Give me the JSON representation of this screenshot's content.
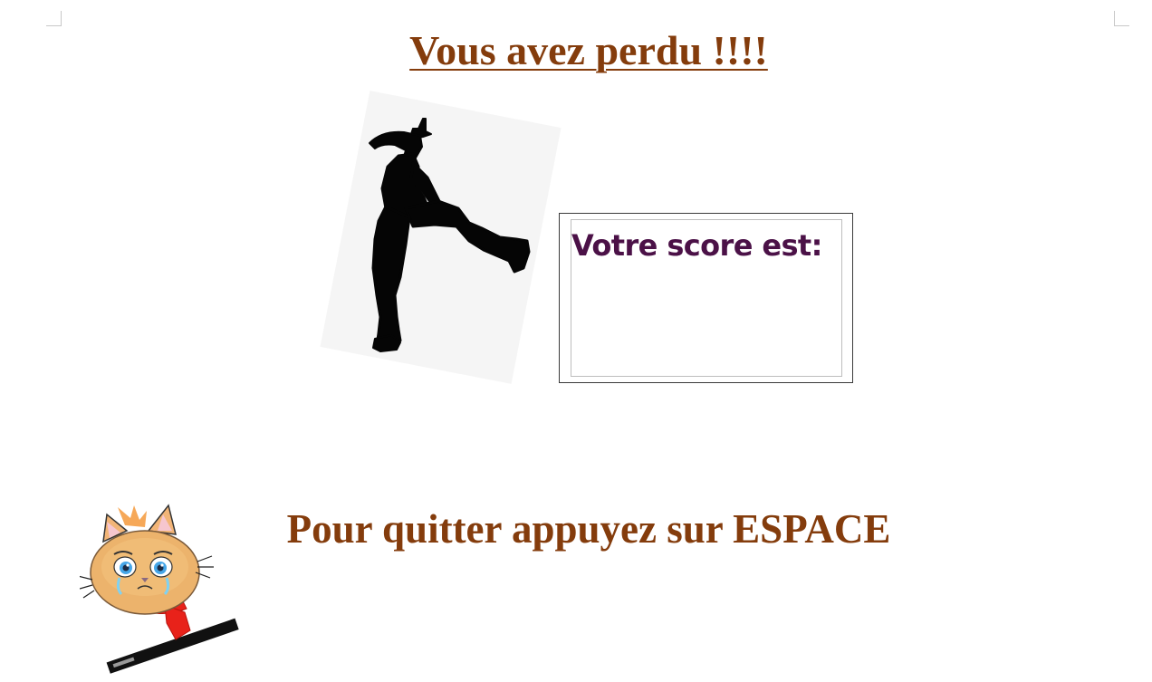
{
  "game": {
    "title": "Vous avez perdu !!!!",
    "score_label": "Votre score est:",
    "score_value": "",
    "quit_instruction": "Pour quitter appuyez sur ESPACE"
  },
  "images": {
    "dancer": "dancing-silhouette-icon",
    "mascot": "crying-cat-icon"
  },
  "colors": {
    "title": "#843c0c",
    "score_label": "#4b1147",
    "quit_instruction": "#843c0c",
    "background": "#ffffff"
  }
}
